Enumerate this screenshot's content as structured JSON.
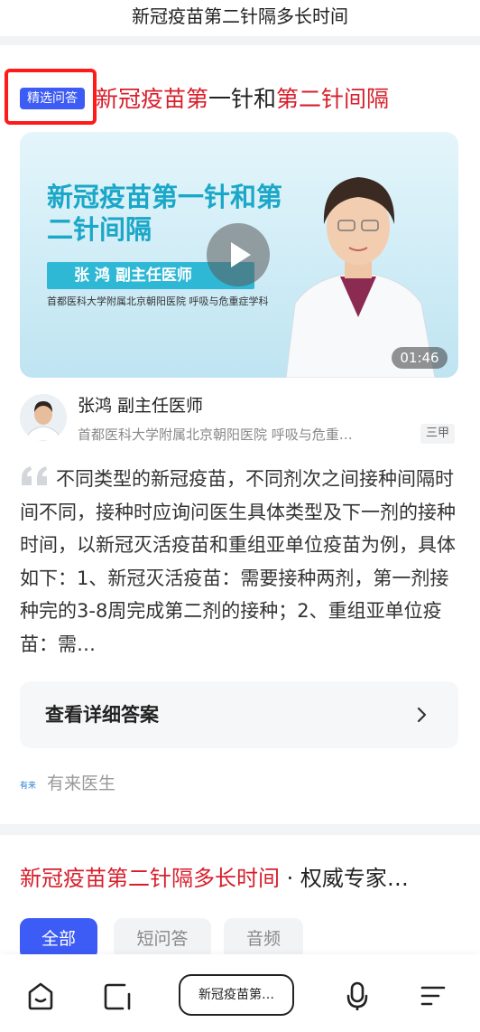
{
  "top": {
    "query_title": "新冠疫苗第二针隔多长时间"
  },
  "card": {
    "badge": "精选问答",
    "heading": {
      "part1": "新冠疫苗第",
      "part2": "一针和",
      "part3": "第二针间隔"
    },
    "video": {
      "title": "新冠疫苗第一针和第二针间隔",
      "presenter": "张  鸿   副主任医师",
      "hospital": "首都医科大学附属北京朝阳医院 呼吸与危重症学科",
      "duration": "01:46"
    },
    "doctor": {
      "name": "张鸿 副主任医师",
      "hospital": "首都医科大学附属北京朝阳医院 呼吸与危重…",
      "grade": "三甲"
    },
    "answer_text": "不同类型的新冠疫苗，不同剂次之间接种间隔时间不同，接种时应询问医生具体类型及下一剂的接种时间，以新冠灭活疫苗和重组亚单位疫苗为例，具体如下：1、新冠灭活疫苗：需要接种两剂，第一剂接种完的3-8周完成第二剂的接种；2、重组亚单位疫苗：需…",
    "detail_button": "查看详细答案",
    "source": {
      "logo_text": "有来",
      "name": "有来医生"
    }
  },
  "result2": {
    "title_red": "新冠疫苗第二针隔多长时间",
    "title_rest": " · 权威专家…"
  },
  "tabs": [
    {
      "label": "全部",
      "active": true
    },
    {
      "label": "短问答",
      "active": false
    },
    {
      "label": "音频",
      "active": false
    }
  ],
  "bottom_bar": {
    "search_text": "新冠疫苗第…",
    "icons": [
      "home-icon",
      "tabs-icon",
      "microphone-icon",
      "menu-icon"
    ]
  },
  "colors": {
    "accent": "#3d5bf5",
    "highlight_red": "#d81e2b",
    "annotation_box": "#ff1a1a"
  }
}
